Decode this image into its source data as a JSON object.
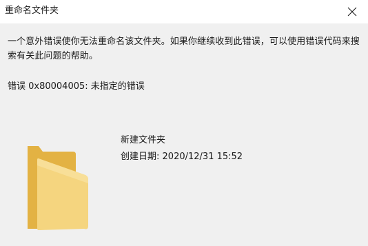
{
  "window": {
    "title": "重命名文件夹",
    "close_icon": "close-icon"
  },
  "message": {
    "body": "一个意外错误使你无法重命名该文件夹。如果你继续收到此错误，可以使用错误代码来搜索有关此问题的帮助。",
    "error": "错误 0x80004005: 未指定的错误"
  },
  "folder": {
    "icon": "folder-icon",
    "name": "新建文件夹",
    "date_label": "创建日期:",
    "date_value": "2020/12/31 15:52"
  },
  "colors": {
    "dialog_bg": "#f0f0f0",
    "titlebar_bg": "#ffffff",
    "folder_back": "#e8b64a",
    "folder_front": "#f6d57e"
  }
}
